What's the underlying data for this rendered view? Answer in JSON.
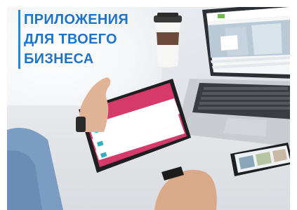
{
  "heading": {
    "lines": [
      "ПРИЛОЖЕНИЯ",
      "ДЛЯ ТВОЕГО",
      "БИЗНЕСА"
    ]
  },
  "colors": {
    "heading": "#1f73c9",
    "accent_bar": "#1e88e5",
    "tablet_screen": "#d63a6b",
    "laptop_brand": "#6dbf4a"
  },
  "scene": {
    "icons": [
      "coffee-cup",
      "laptop",
      "tablet",
      "smartphone",
      "hands"
    ]
  }
}
